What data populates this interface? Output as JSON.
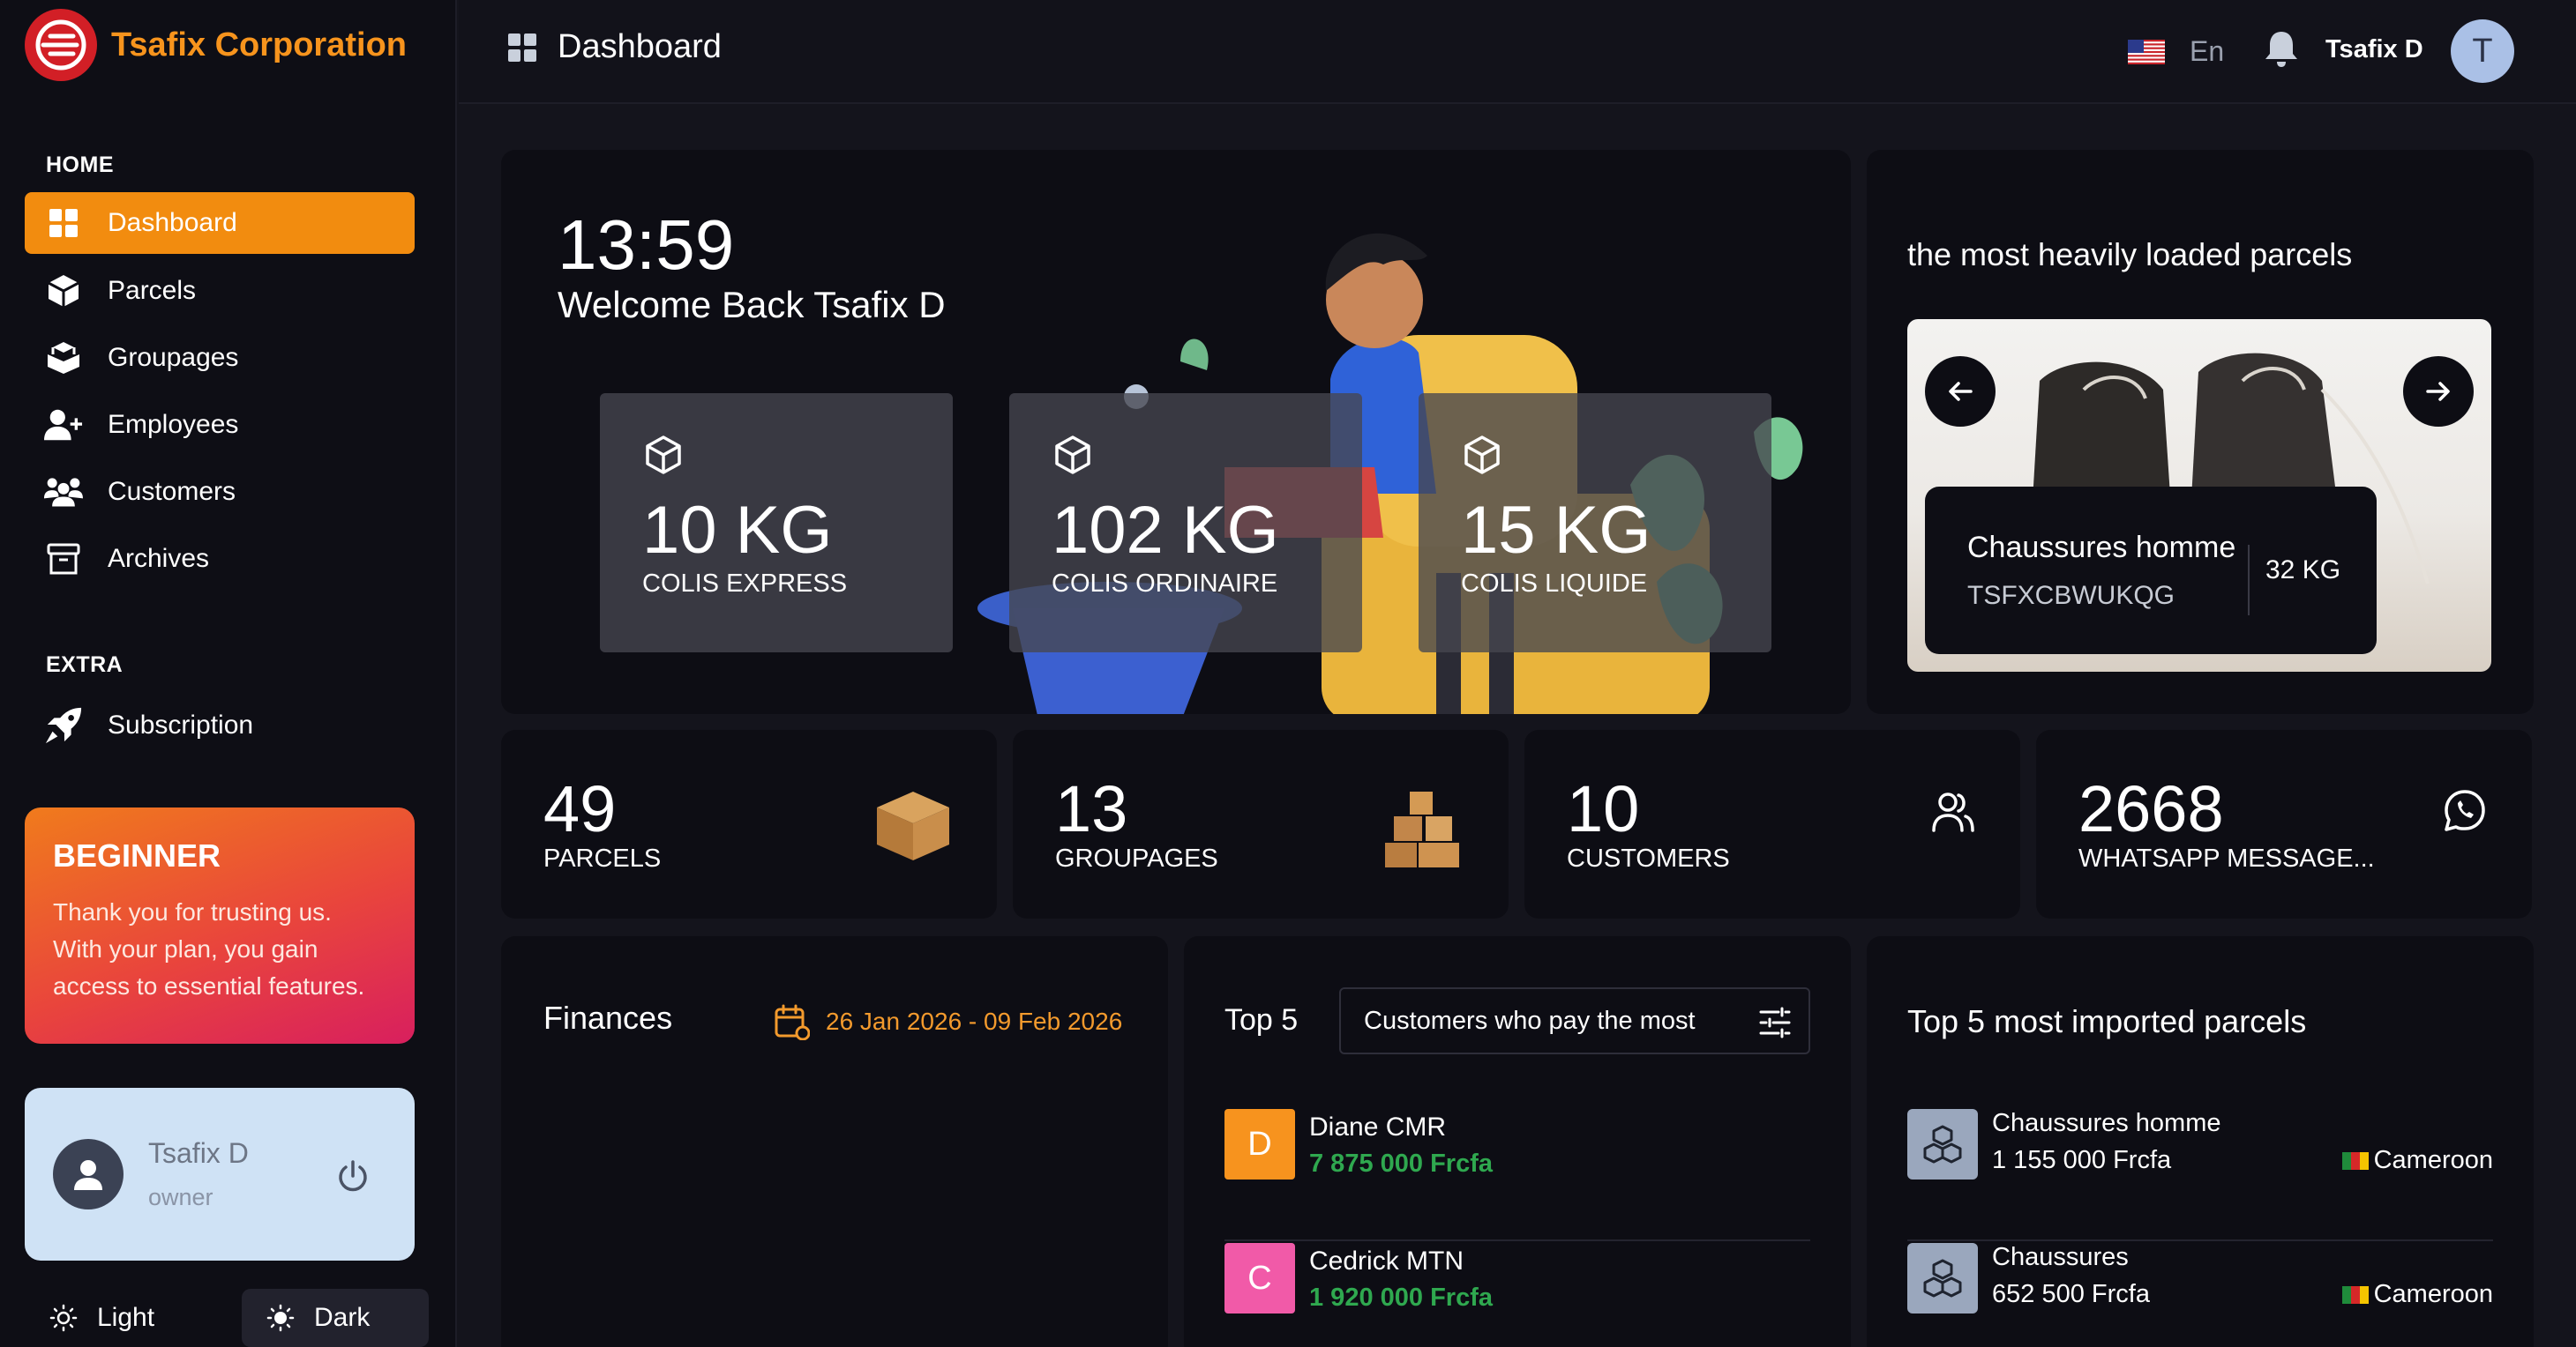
{
  "brand": {
    "name": "Tsafix Corporation"
  },
  "sidebar": {
    "section_home": "HOME",
    "section_extra": "EXTRA",
    "items": [
      {
        "label": "Dashboard",
        "icon": "grid-icon",
        "active": true
      },
      {
        "label": "Parcels",
        "icon": "box-icon"
      },
      {
        "label": "Groupages",
        "icon": "boxes-icon"
      },
      {
        "label": "Employees",
        "icon": "user-plus-icon"
      },
      {
        "label": "Customers",
        "icon": "users-icon"
      },
      {
        "label": "Archives",
        "icon": "archive-icon"
      }
    ],
    "extra_items": [
      {
        "label": "Subscription",
        "icon": "rocket-icon"
      }
    ],
    "plan": {
      "title": "BEGINNER",
      "text": "Thank you for trusting us. With your plan, you gain access to essential features."
    },
    "user": {
      "name": "Tsafix D",
      "role": "owner"
    },
    "theme": {
      "light_label": "Light",
      "dark_label": "Dark"
    }
  },
  "header": {
    "title": "Dashboard",
    "language": "En",
    "user_name": "Tsafix D",
    "avatar_letter": "T"
  },
  "hero": {
    "time": "13:59",
    "welcome": "Welcome Back Tsafix D",
    "weights": [
      {
        "value": "10 KG",
        "label": "COLIS EXPRESS"
      },
      {
        "value": "102 KG",
        "label": "COLIS ORDINAIRE"
      },
      {
        "value": "15 KG",
        "label": "COLIS LIQUIDE"
      }
    ]
  },
  "loaded_parcels": {
    "title": "the most heavily loaded parcels",
    "item": {
      "name": "Chaussures homme",
      "code": "TSFXCBWUKQG",
      "weight": "32 KG"
    }
  },
  "stats": [
    {
      "value": "49",
      "label": "PARCELS",
      "icon": "package-icon"
    },
    {
      "value": "13",
      "label": "GROUPAGES",
      "icon": "stacked-boxes-icon"
    },
    {
      "value": "10",
      "label": "CUSTOMERS",
      "icon": "users-outline-icon"
    },
    {
      "value": "2668",
      "label": "WHATSAPP MESSAGE...",
      "icon": "whatsapp-icon"
    }
  ],
  "finances": {
    "title": "Finances",
    "date_range": "26 Jan 2026 - 09 Feb 2026"
  },
  "top5": {
    "title": "Top 5",
    "filter": "Customers who pay the most",
    "rows": [
      {
        "initial": "D",
        "name": "Diane CMR",
        "amount": "7 875 000 Frcfa",
        "color": "#f7931e"
      },
      {
        "initial": "C",
        "name": "Cedrick MTN",
        "amount": "1 920 000 Frcfa",
        "color": "#f15aa8"
      }
    ]
  },
  "imported": {
    "title": "Top 5 most imported parcels",
    "rows": [
      {
        "name": "Chaussures homme",
        "amount": "1 155 000 Frcfa",
        "country": "Cameroon"
      },
      {
        "name": "Chaussures",
        "amount": "652 500 Frcfa",
        "country": "Cameroon"
      }
    ]
  },
  "colors": {
    "accent": "#f28c0f",
    "brand_red": "#d21f26",
    "success": "#2fa84f"
  }
}
